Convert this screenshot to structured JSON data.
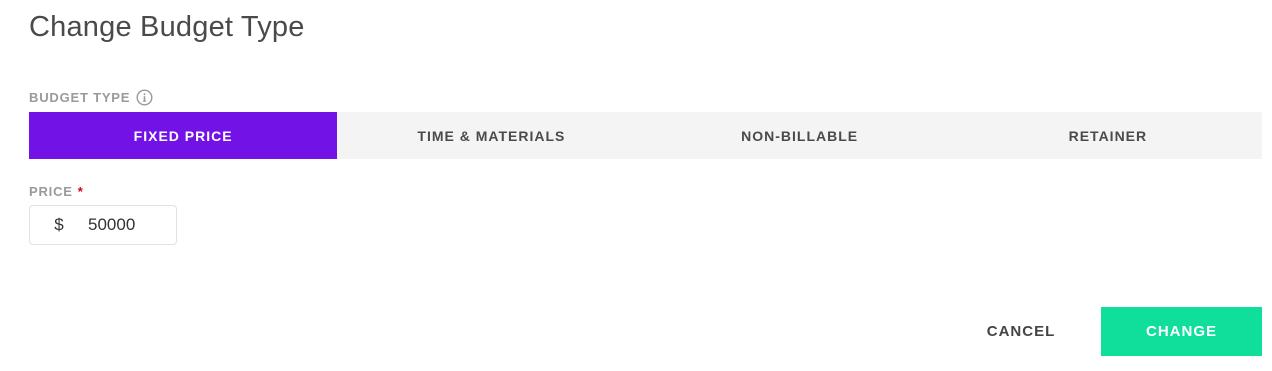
{
  "dialog": {
    "title": "Change Budget Type"
  },
  "budget_type": {
    "label": "BUDGET TYPE",
    "info_icon": "info-icon",
    "options": [
      {
        "label": "FIXED PRICE",
        "selected": true
      },
      {
        "label": "TIME & MATERIALS",
        "selected": false
      },
      {
        "label": "NON-BILLABLE",
        "selected": false
      },
      {
        "label": "RETAINER",
        "selected": false
      }
    ],
    "active_color": "#7212E6"
  },
  "price": {
    "label": "PRICE",
    "required_marker": "*",
    "currency_symbol": "$",
    "value": "50000"
  },
  "actions": {
    "cancel_label": "CANCEL",
    "change_label": "CHANGE",
    "change_color": "#0FDF9B"
  }
}
